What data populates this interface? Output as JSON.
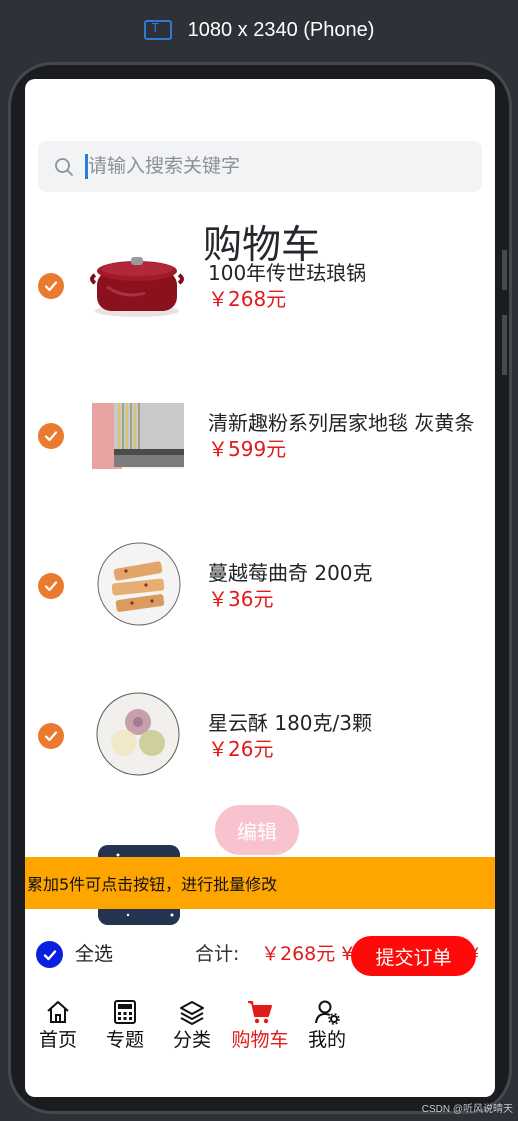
{
  "device": {
    "label": "1080 x 2340 (Phone)"
  },
  "search": {
    "placeholder": "请输入搜索关键字"
  },
  "page": {
    "title": "购物车"
  },
  "items": [
    {
      "name": "100年传世珐琅锅",
      "price": "￥268元",
      "checked": true
    },
    {
      "name": "清新趣粉系列居家地毯 灰黄条",
      "price": "￥599元",
      "checked": true
    },
    {
      "name": "蔓越莓曲奇 200克",
      "price": "￥36元",
      "checked": true
    },
    {
      "name": "星云酥 180克/3颗",
      "price": "￥26元",
      "checked": true
    }
  ],
  "edit_button": {
    "label": "编辑"
  },
  "notice": {
    "text": "累加5件可点击按钮，进行批量修改"
  },
  "footer": {
    "select_all_label": "全选",
    "total_label": "合计:",
    "total_value": "￥268元 ¥",
    "total_value_overlap": "¥",
    "overflow_text": "¥",
    "submit_label": "提交订单"
  },
  "nav": {
    "items": [
      {
        "label": "首页",
        "icon": "home-icon",
        "active": false
      },
      {
        "label": "专题",
        "icon": "calculator-icon",
        "active": false
      },
      {
        "label": "分类",
        "icon": "layers-icon",
        "active": false
      },
      {
        "label": "购物车",
        "icon": "cart-icon",
        "active": true
      },
      {
        "label": "我的",
        "icon": "user-settings-icon",
        "active": false
      }
    ]
  },
  "watermark": "CSDN @听风说晴天",
  "colors": {
    "accent_orange": "#ea7a2f",
    "price_red": "#e21a1a",
    "submit_red": "#ff0a0a",
    "notice_bg": "#ffa500",
    "select_all_blue": "#0b1fe0",
    "edit_pink": "#f8c3cf"
  }
}
